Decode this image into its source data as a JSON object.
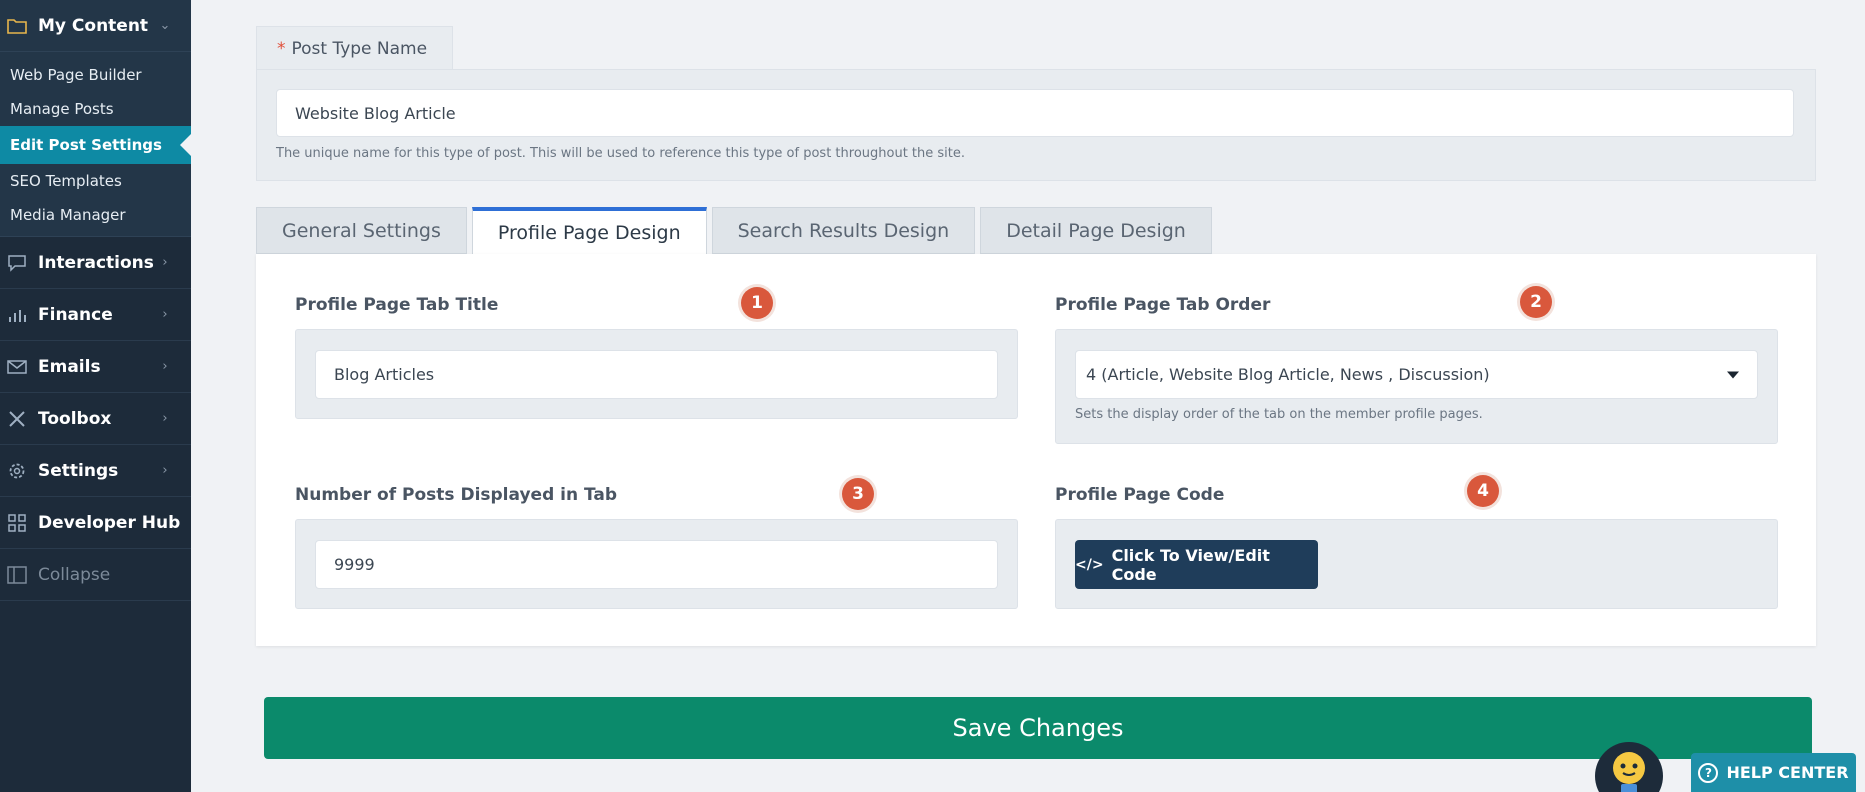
{
  "sidebar": {
    "header": {
      "label": "My Content",
      "icon": "folder-icon"
    },
    "sub_items": [
      {
        "label": "Web Page Builder",
        "active": false
      },
      {
        "label": "Manage Posts",
        "active": false
      },
      {
        "label": "Edit Post Settings",
        "active": true
      },
      {
        "label": "SEO Templates",
        "active": false
      },
      {
        "label": "Media Manager",
        "active": false
      }
    ],
    "items": [
      {
        "label": "Interactions",
        "icon": "chat-icon"
      },
      {
        "label": "Finance",
        "icon": "bar-chart-icon"
      },
      {
        "label": "Emails",
        "icon": "mail-icon"
      },
      {
        "label": "Toolbox",
        "icon": "tools-icon"
      },
      {
        "label": "Settings",
        "icon": "gear-icon"
      },
      {
        "label": "Developer Hub",
        "icon": "grid-icon"
      },
      {
        "label": "Collapse",
        "icon": "collapse-icon"
      }
    ]
  },
  "post_type": {
    "label": "Post Type Name",
    "required_mark": "*",
    "value": "Website Blog Article",
    "hint": "The unique name for this type of post. This will be used to reference this type of post throughout the site."
  },
  "tabs": [
    {
      "label": "General Settings"
    },
    {
      "label": "Profile Page Design"
    },
    {
      "label": "Search Results Design"
    },
    {
      "label": "Detail Page Design"
    }
  ],
  "fields": {
    "tab_title": {
      "label": "Profile Page Tab Title",
      "badge": "1",
      "value": "Blog Articles"
    },
    "tab_order": {
      "label": "Profile Page Tab Order",
      "badge": "2",
      "value": "4 (Article, Website Blog Article, News , Discussion)",
      "hint": "Sets the display order of the tab on the member profile pages."
    },
    "posts_count": {
      "label": "Number of Posts Displayed in Tab",
      "badge": "3",
      "value": "9999"
    },
    "page_code": {
      "label": "Profile Page Code",
      "badge": "4",
      "button": "Click To View/Edit Code"
    }
  },
  "save_label": "Save Changes",
  "help_label": "HELP CENTER",
  "colors": {
    "sidebar": "#1d2b3a",
    "active_item": "#0e8aa4",
    "save": "#0b8a6b",
    "badge": "#d9583c",
    "tab_accent": "#2e6fd6"
  }
}
